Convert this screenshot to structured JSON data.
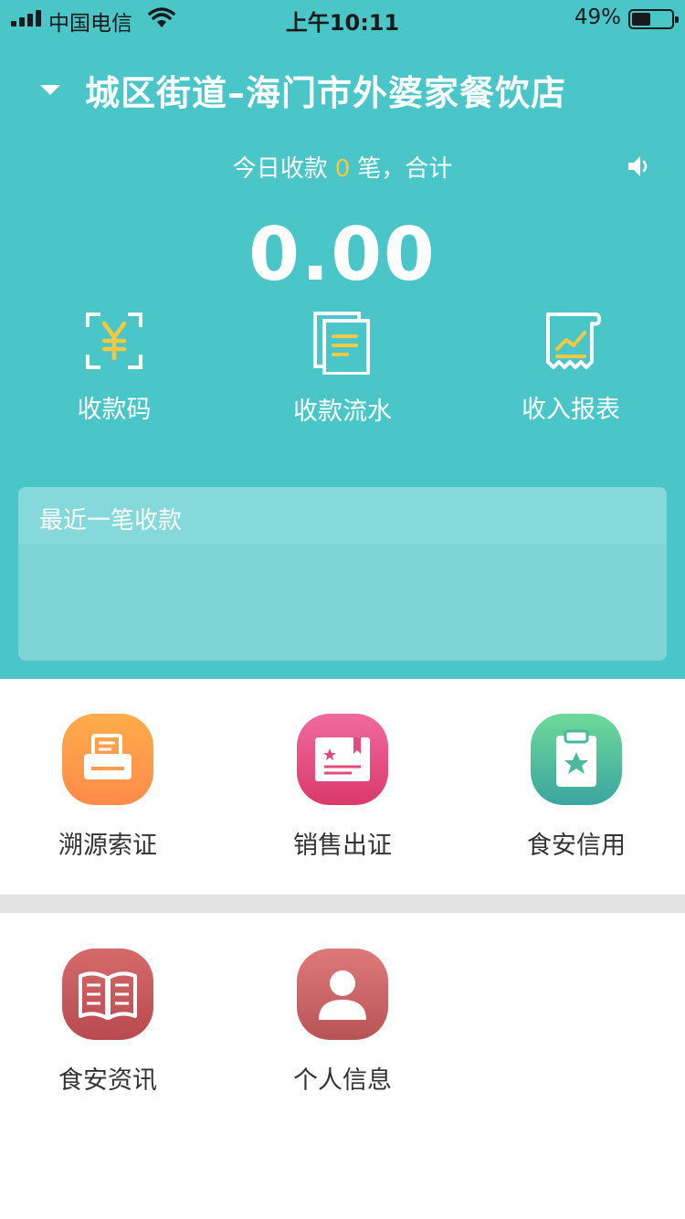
{
  "status_bar": {
    "carrier": "中国电信",
    "time": "上午10:11",
    "battery_percent": "49%",
    "battery_level": 0.49
  },
  "header": {
    "store_name": "城区街道–海门市外婆家餐饮店",
    "today_prefix": "今日收款",
    "today_count": "0",
    "today_suffix": "笔，合计",
    "amount": "0.00"
  },
  "quick_actions": [
    {
      "label": "收款码",
      "icon": "yuan-qr-icon"
    },
    {
      "label": "收款流水",
      "icon": "documents-icon"
    },
    {
      "label": "收入报表",
      "icon": "report-chart-icon"
    }
  ],
  "recent_card": {
    "title": "最近一笔收款"
  },
  "menu_items": [
    {
      "label": "溯源索证",
      "icon": "printer-icon",
      "color": "#ff9148"
    },
    {
      "label": "销售出证",
      "icon": "certificate-icon",
      "color": "#e8497a"
    },
    {
      "label": "食安信用",
      "icon": "clipboard-star-icon",
      "color": "#4ab89a"
    },
    {
      "label": "食安资讯",
      "icon": "book-icon",
      "color": "#c8565a"
    },
    {
      "label": "个人信息",
      "icon": "person-icon",
      "color": "#cc6466"
    }
  ],
  "colors": {
    "header_bg": "#4ac6c9",
    "accent_yellow": "#f5c842"
  }
}
